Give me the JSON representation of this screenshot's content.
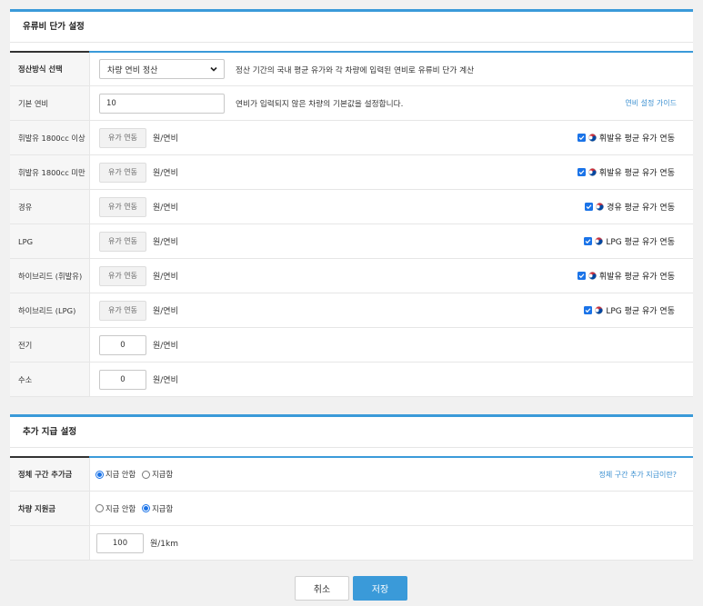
{
  "fuel_panel": {
    "title": "유류비 단가 설정",
    "settle_method": {
      "label": "정산방식 선택",
      "selected": "차량 연비 정산",
      "hint": "정산 기간의 국내 평균 유가와 각 차량에 입력된 연비로 유류비 단가 계산"
    },
    "base_eff": {
      "label": "기본 연비",
      "value": "10",
      "hint": "연비가 입력되지 않은 차량의 기본값을 설정합니다.",
      "guide_link": "연비 설정 가이드"
    },
    "unit_text": "원/연비",
    "ro_text": "유가 연동",
    "rows": [
      {
        "label": "휘발유 1800cc 이상",
        "check_label": "휘발유 평균 유가 연동"
      },
      {
        "label": "휘발유 1800cc 미만",
        "check_label": "휘발유 평균 유가 연동"
      },
      {
        "label": "경유",
        "check_label": "경유 평균 유가 연동"
      },
      {
        "label": "LPG",
        "check_label": "LPG 평균 유가 연동"
      },
      {
        "label": "하이브리드 (휘발유)",
        "check_label": "휘발유 평균 유가 연동"
      },
      {
        "label": "하이브리드 (LPG)",
        "check_label": "LPG 평균 유가 연동"
      }
    ],
    "electric": {
      "label": "전기",
      "value": "0"
    },
    "hydrogen": {
      "label": "수소",
      "value": "0"
    }
  },
  "extra_panel": {
    "title": "추가 지급 설정",
    "jam": {
      "label": "정체 구간 추가금",
      "opt_no": "지급 안함",
      "opt_yes": "지급함",
      "selected": "no",
      "link": "정체 구간 추가 지급이란?"
    },
    "support": {
      "label": "차량 지원금",
      "opt_no": "지급 안함",
      "opt_yes": "지급함",
      "selected": "yes"
    },
    "amount": {
      "value": "100",
      "unit": "원/1km"
    }
  },
  "footer": {
    "cancel_label": "취소",
    "save_label": "저장"
  },
  "colors": {
    "accent": "#3a9ad9",
    "checkbox": "#1a73e8"
  }
}
